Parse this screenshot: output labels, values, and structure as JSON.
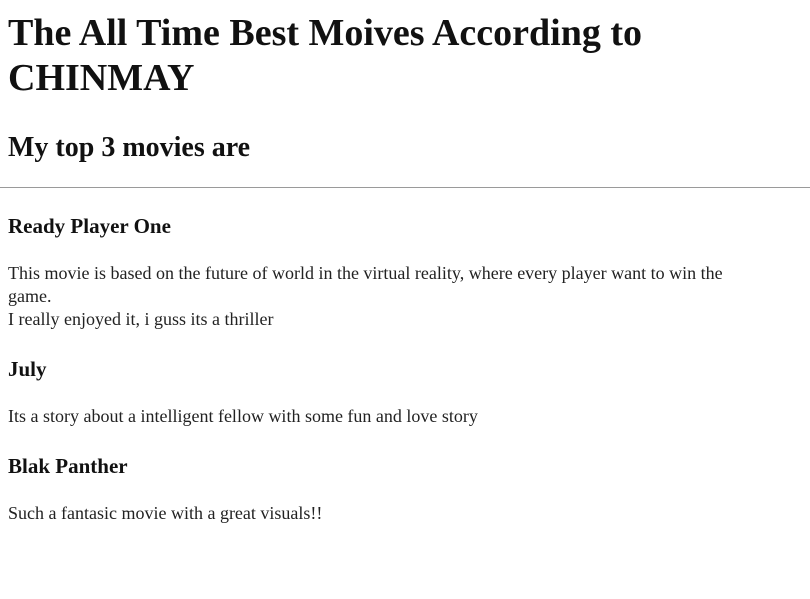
{
  "page": {
    "title_line1": "The All Time Best Moives According to",
    "title_line2": "CHINMAY",
    "subtitle": "My top 3 movies are"
  },
  "movies": [
    {
      "name": "Ready Player One",
      "description_lines": [
        "This movie is based on the future of world in the virtual reality, where every player want to win the",
        "game.",
        "I really enjoyed it, i guss its a thriller"
      ]
    },
    {
      "name": "July",
      "description_lines": [
        "Its a story about a intelligent fellow with some fun and love story"
      ]
    },
    {
      "name": "Blak Panther",
      "description_lines": [
        "Such a fantasic movie with a great visuals!!"
      ]
    }
  ]
}
